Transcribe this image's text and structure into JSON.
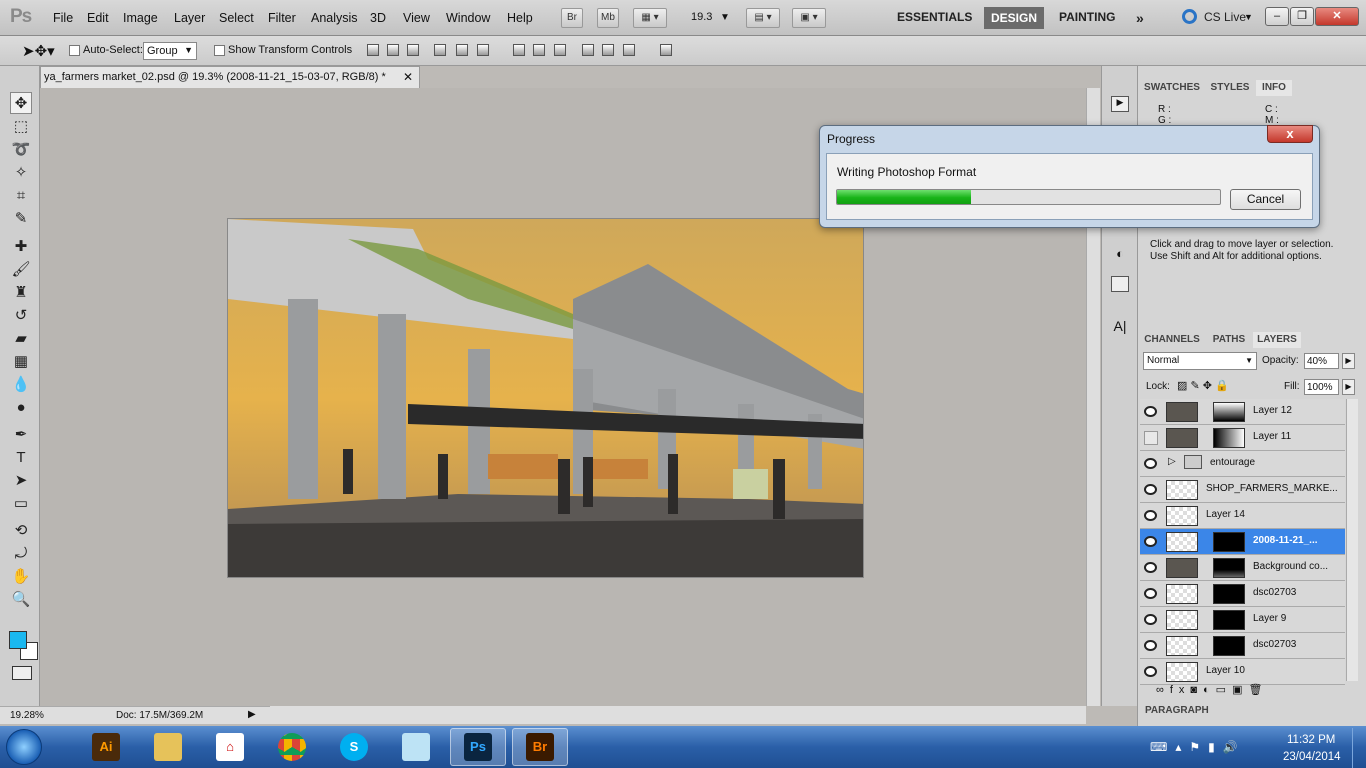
{
  "app": {
    "logo": "Ps"
  },
  "menu": [
    "File",
    "Edit",
    "Image",
    "Layer",
    "Select",
    "Filter",
    "Analysis",
    "3D",
    "View",
    "Window",
    "Help"
  ],
  "appbar": {
    "br": "Br",
    "mb": "Mb",
    "zoom": "19.3"
  },
  "workspaces": {
    "essentials": "ESSENTIALS",
    "design": "DESIGN",
    "painting": "PAINTING",
    "cslive": "CS Live"
  },
  "options": {
    "auto_select_label": "Auto-Select:",
    "auto_select_value": "Group",
    "show_transform_label": "Show Transform Controls"
  },
  "document": {
    "tab_title": "ya_farmers market_02.psd @ 19.3% (2008-11-21_15-03-07, RGB/8) *",
    "zoom": "19.28%",
    "doc_size": "Doc: 17.5M/369.2M"
  },
  "panels": {
    "top_tabs": [
      "SWATCHES",
      "STYLES",
      "INFO"
    ],
    "info": {
      "r": "R :",
      "g": "G :",
      "c": "C :",
      "m": "M :"
    },
    "help_text_1": "Click and drag to move layer or selection.",
    "help_text_2": "Use Shift and Alt for additional options.",
    "layer_tabs": [
      "CHANNELS",
      "PATHS",
      "LAYERS"
    ],
    "blend_mode": "Normal",
    "opacity_label": "Opacity:",
    "opacity_value": "40%",
    "lock_label": "Lock:",
    "fill_label": "Fill:",
    "fill_value": "100%",
    "paragraph_tab": "PARAGRAPH"
  },
  "layers": [
    {
      "name": "Layer 12",
      "visible": true
    },
    {
      "name": "Layer 11",
      "visible": false
    },
    {
      "name": "entourage",
      "visible": true
    },
    {
      "name": "SHOP_FARMERS_MARKE...",
      "visible": true
    },
    {
      "name": "Layer 14",
      "visible": true
    },
    {
      "name": "2008-11-21_...",
      "visible": true,
      "selected": true
    },
    {
      "name": "Background co...",
      "visible": true
    },
    {
      "name": "dsc02703",
      "visible": true
    },
    {
      "name": "Layer 9",
      "visible": true
    },
    {
      "name": "dsc02703",
      "visible": true
    },
    {
      "name": "Layer 10",
      "visible": true
    }
  ],
  "dialog": {
    "title": "Progress",
    "message": "Writing Photoshop Format",
    "progress": 0.35,
    "cancel_label": "Cancel",
    "close_glyph": "x"
  },
  "taskbar": {
    "time": "11:32 PM",
    "date": "23/04/2014",
    "apps": [
      "Ai",
      "Explorer",
      "Acrobat",
      "Chrome",
      "Skype",
      "Notepad",
      "Ps",
      "Br"
    ]
  },
  "colors": {
    "foreground": "#1ab8f0",
    "background": "#ffffff",
    "accent": "#3b86e8",
    "progress": "#18b418"
  }
}
